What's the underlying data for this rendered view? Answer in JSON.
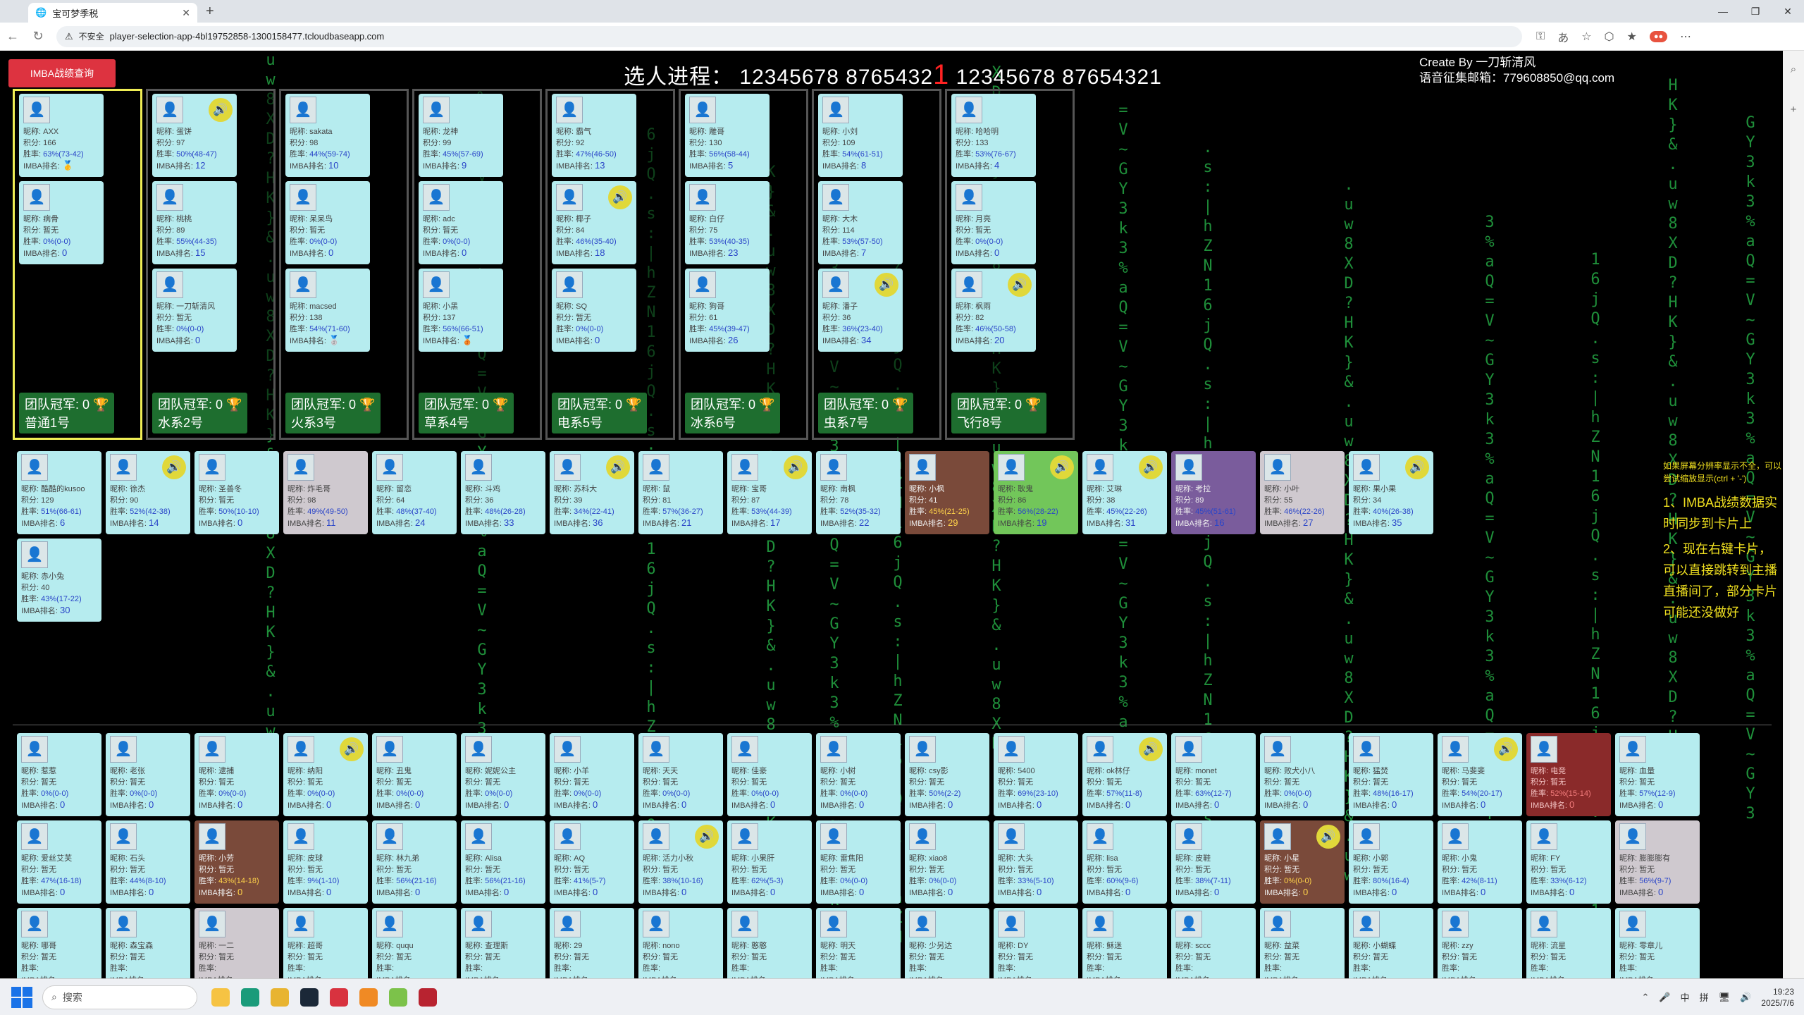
{
  "browser": {
    "tab_title": "宝可梦季税",
    "url": "player-selection-app-4bl19752858-1300158477.tcloudbaseapp.com",
    "security_label": "不安全"
  },
  "header": {
    "title_prefix": "选人进程：",
    "code_left": "12345678 8765432",
    "cursor_digit": "1",
    "code_right": "12345678 87654321",
    "creator_line1": "Create By 一刀斩清风",
    "creator_line2": "语音征集邮箱：779608850@qq.com",
    "query_button": "IMBA战绩查询"
  },
  "labels": {
    "nick": "昵称:",
    "score": "积分:",
    "winrate": "胜率:",
    "rank": "IMBA排名:",
    "team_champ": "团队冠军:"
  },
  "teams": [
    {
      "name": "普通1号",
      "champ": "0",
      "selected": true,
      "members": [
        {
          "nick": "AXX",
          "score": "166",
          "winrate": "63%(73-42)",
          "rank": "🥇"
        },
        {
          "nick": "病骨",
          "score": "暂无",
          "winrate": "0%(0-0)",
          "rank": "0"
        }
      ]
    },
    {
      "name": "水系2号",
      "champ": "0",
      "members": [
        {
          "nick": "蛋饼",
          "score": "97",
          "winrate": "50%(48-47)",
          "rank": "12",
          "spk": true
        },
        {
          "nick": "桃桃",
          "score": "89",
          "winrate": "55%(44-35)",
          "rank": "15"
        },
        {
          "nick": "一刀斩清风",
          "score": "暂无",
          "winrate": "0%(0-0)",
          "rank": "0"
        }
      ]
    },
    {
      "name": "火系3号",
      "champ": "0",
      "members": [
        {
          "nick": "sakata",
          "score": "98",
          "winrate": "44%(59-74)",
          "rank": "10"
        },
        {
          "nick": "呆呆鸟",
          "score": "暂无",
          "winrate": "0%(0-0)",
          "rank": "0"
        },
        {
          "nick": "macsed",
          "score": "138",
          "winrate": "54%(71-60)",
          "rank": "🥈"
        }
      ]
    },
    {
      "name": "草系4号",
      "champ": "0",
      "members": [
        {
          "nick": "龙神",
          "score": "99",
          "winrate": "45%(57-69)",
          "rank": "9"
        },
        {
          "nick": "adc",
          "score": "暂无",
          "winrate": "0%(0-0)",
          "rank": "0"
        },
        {
          "nick": "小黑",
          "score": "137",
          "winrate": "56%(66-51)",
          "rank": "🥉"
        }
      ]
    },
    {
      "name": "电系5号",
      "champ": "0",
      "members": [
        {
          "nick": "霸气",
          "score": "92",
          "winrate": "47%(46-50)",
          "rank": "13"
        },
        {
          "nick": "椰子",
          "score": "84",
          "winrate": "46%(35-40)",
          "rank": "18",
          "spk": true
        },
        {
          "nick": "SQ",
          "score": "暂无",
          "winrate": "0%(0-0)",
          "rank": "0"
        }
      ]
    },
    {
      "name": "冰系6号",
      "champ": "0",
      "members": [
        {
          "nick": "雕哥",
          "score": "130",
          "winrate": "56%(58-44)",
          "rank": "5"
        },
        {
          "nick": "白仔",
          "score": "75",
          "winrate": "53%(40-35)",
          "rank": "23"
        },
        {
          "nick": "狗哥",
          "score": "61",
          "winrate": "45%(39-47)",
          "rank": "26"
        }
      ]
    },
    {
      "name": "虫系7号",
      "champ": "0",
      "members": [
        {
          "nick": "小刘",
          "score": "109",
          "winrate": "54%(61-51)",
          "rank": "8"
        },
        {
          "nick": "大木",
          "score": "114",
          "winrate": "53%(57-50)",
          "rank": "7"
        },
        {
          "nick": "潘子",
          "score": "36",
          "winrate": "36%(23-40)",
          "rank": "34",
          "spk": true
        }
      ]
    },
    {
      "name": "飞行8号",
      "champ": "0",
      "members": [
        {
          "nick": "哈哈明",
          "score": "133",
          "winrate": "53%(76-67)",
          "rank": "4"
        },
        {
          "nick": "月亮",
          "score": "暂无",
          "winrate": "0%(0-0)",
          "rank": "0"
        },
        {
          "nick": "枫雨",
          "score": "82",
          "winrate": "46%(50-58)",
          "rank": "20",
          "spk": true
        }
      ]
    }
  ],
  "pool_ranked": [
    {
      "nick": "酷酷的kusoo",
      "score": "129",
      "winrate": "51%(66-61)",
      "rank": "6"
    },
    {
      "nick": "徐杰",
      "score": "90",
      "winrate": "52%(42-38)",
      "rank": "14",
      "spk": true
    },
    {
      "nick": "圣善冬",
      "score": "暂无",
      "winrate": "50%(10-10)",
      "rank": "0"
    },
    {
      "nick": "炸毛哥",
      "score": "98",
      "winrate": "49%(49-50)",
      "rank": "11",
      "style": "grey"
    },
    {
      "nick": "留恋",
      "score": "64",
      "winrate": "48%(37-40)",
      "rank": "24"
    },
    {
      "nick": "斗鸡",
      "score": "36",
      "winrate": "48%(26-28)",
      "rank": "33"
    },
    {
      "nick": "苏科大",
      "score": "39",
      "winrate": "34%(22-41)",
      "rank": "36",
      "spk": true
    },
    {
      "nick": "鼠",
      "score": "81",
      "winrate": "57%(36-27)",
      "rank": "21"
    },
    {
      "nick": "宝哥",
      "score": "87",
      "winrate": "53%(44-39)",
      "rank": "17",
      "spk": true
    },
    {
      "nick": "南枫",
      "score": "78",
      "winrate": "52%(35-32)",
      "rank": "22"
    },
    {
      "nick": "小枫",
      "score": "41",
      "winrate": "45%(21-25)",
      "rank": "29",
      "style": "dark"
    },
    {
      "nick": "耿鬼",
      "score": "86",
      "winrate": "56%(28-22)",
      "rank": "19",
      "style": "green",
      "spk": true
    },
    {
      "nick": "艾琳",
      "score": "38",
      "winrate": "45%(22-26)",
      "rank": "31",
      "spk": true
    },
    {
      "nick": "考拉",
      "score": "89",
      "winrate": "45%(51-61)",
      "rank": "16",
      "style": "purple"
    },
    {
      "nick": "小叶",
      "score": "55",
      "winrate": "46%(22-26)",
      "rank": "27",
      "style": "grey"
    },
    {
      "nick": "果小果",
      "score": "34",
      "winrate": "40%(26-38)",
      "rank": "35",
      "spk": true
    },
    {
      "nick": "赤小兔",
      "score": "40",
      "winrate": "43%(17-22)",
      "rank": "30"
    }
  ],
  "pool_other": [
    {
      "nick": "惹惹",
      "score": "暂无",
      "winrate": "0%(0-0)",
      "rank": "0"
    },
    {
      "nick": "老张",
      "score": "暂无",
      "winrate": "0%(0-0)",
      "rank": "0"
    },
    {
      "nick": "逮捕",
      "score": "暂无",
      "winrate": "0%(0-0)",
      "rank": "0"
    },
    {
      "nick": "纳阳",
      "score": "暂无",
      "winrate": "0%(0-0)",
      "rank": "0",
      "spk": true
    },
    {
      "nick": "丑鬼",
      "score": "暂无",
      "winrate": "0%(0-0)",
      "rank": "0"
    },
    {
      "nick": "妮妮公主",
      "score": "暂无",
      "winrate": "0%(0-0)",
      "rank": "0"
    },
    {
      "nick": "小羊",
      "score": "暂无",
      "winrate": "0%(0-0)",
      "rank": "0"
    },
    {
      "nick": "天天",
      "score": "暂无",
      "winrate": "0%(0-0)",
      "rank": "0"
    },
    {
      "nick": "佳豪",
      "score": "暂无",
      "winrate": "0%(0-0)",
      "rank": "0"
    },
    {
      "nick": "小树",
      "score": "暂无",
      "winrate": "0%(0-0)",
      "rank": "0"
    },
    {
      "nick": "csy影",
      "score": "暂无",
      "winrate": "50%(2-2)",
      "rank": "0"
    },
    {
      "nick": "5400",
      "score": "暂无",
      "winrate": "69%(23-10)",
      "rank": "0"
    },
    {
      "nick": "ok林仔",
      "score": "暂无",
      "winrate": "57%(11-8)",
      "rank": "0",
      "spk": true
    },
    {
      "nick": "monet",
      "score": "暂无",
      "winrate": "63%(12-7)",
      "rank": "0"
    },
    {
      "nick": "败犬小八",
      "score": "暂无",
      "winrate": "0%(0-0)",
      "rank": "0"
    },
    {
      "nick": "猛焚",
      "score": "暂无",
      "winrate": "48%(16-17)",
      "rank": "0"
    },
    {
      "nick": "马斐斐",
      "score": "暂无",
      "winrate": "54%(20-17)",
      "rank": "0",
      "spk": true
    },
    {
      "nick": "电竞",
      "score": "暂无",
      "winrate": "52%(15-14)",
      "rank": "0",
      "style": "red"
    },
    {
      "nick": "血量",
      "score": "暂无",
      "winrate": "57%(12-9)",
      "rank": "0"
    },
    {
      "nick": "爱丝艾芙",
      "score": "暂无",
      "winrate": "47%(16-18)",
      "rank": "0"
    },
    {
      "nick": "石头",
      "score": "暂无",
      "winrate": "44%(8-10)",
      "rank": "0"
    },
    {
      "nick": "小芳",
      "score": "暂无",
      "winrate": "43%(14-18)",
      "rank": "0",
      "style": "dark"
    },
    {
      "nick": "皮球",
      "score": "暂无",
      "winrate": "9%(1-10)",
      "rank": "0"
    },
    {
      "nick": "林九弟",
      "score": "暂无",
      "winrate": "56%(21-16)",
      "rank": "0"
    },
    {
      "nick": "Alisa",
      "score": "暂无",
      "winrate": "56%(21-16)",
      "rank": "0"
    },
    {
      "nick": "AQ",
      "score": "暂无",
      "winrate": "41%(5-7)",
      "rank": "0"
    },
    {
      "nick": "活力小秋",
      "score": "暂无",
      "winrate": "38%(10-16)",
      "rank": "0",
      "spk": true
    },
    {
      "nick": "小果肝",
      "score": "暂无",
      "winrate": "62%(5-3)",
      "rank": "0"
    },
    {
      "nick": "雷焦阳",
      "score": "暂无",
      "winrate": "0%(0-0)",
      "rank": "0"
    },
    {
      "nick": "xiao8",
      "score": "暂无",
      "winrate": "0%(0-0)",
      "rank": "0"
    },
    {
      "nick": "大头",
      "score": "暂无",
      "winrate": "33%(5-10)",
      "rank": "0"
    },
    {
      "nick": "lisa",
      "score": "暂无",
      "winrate": "60%(9-6)",
      "rank": "0"
    },
    {
      "nick": "皮鞋",
      "score": "暂无",
      "winrate": "38%(7-11)",
      "rank": "0"
    },
    {
      "nick": "小星",
      "score": "暂无",
      "winrate": "0%(0-0)",
      "rank": "0",
      "style": "dark",
      "spk": true
    },
    {
      "nick": "小郭",
      "score": "暂无",
      "winrate": "80%(16-4)",
      "rank": "0"
    },
    {
      "nick": "小鬼",
      "score": "暂无",
      "winrate": "42%(8-11)",
      "rank": "0"
    },
    {
      "nick": "FY",
      "score": "暂无",
      "winrate": "33%(6-12)",
      "rank": "0"
    },
    {
      "nick": "膨膨膨有",
      "score": "暂无",
      "winrate": "56%(9-7)",
      "rank": "0",
      "style": "grey"
    },
    {
      "nick": "哪哥",
      "score": "暂无",
      "winrate": "",
      "rank": ""
    },
    {
      "nick": "森宝森",
      "score": "暂无",
      "winrate": "",
      "rank": ""
    },
    {
      "nick": "一二",
      "score": "暂无",
      "winrate": "",
      "rank": "",
      "style": "grey"
    },
    {
      "nick": "超哥",
      "score": "暂无",
      "winrate": "",
      "rank": ""
    },
    {
      "nick": "ququ",
      "score": "暂无",
      "winrate": "",
      "rank": ""
    },
    {
      "nick": "查理斯",
      "score": "暂无",
      "winrate": "",
      "rank": ""
    },
    {
      "nick": "29",
      "score": "暂无",
      "winrate": "",
      "rank": ""
    },
    {
      "nick": "nono",
      "score": "暂无",
      "winrate": "",
      "rank": ""
    },
    {
      "nick": "憨憨",
      "score": "暂无",
      "winrate": "",
      "rank": ""
    },
    {
      "nick": "明天",
      "score": "暂无",
      "winrate": "",
      "rank": ""
    },
    {
      "nick": "少另达",
      "score": "暂无",
      "winrate": "",
      "rank": ""
    },
    {
      "nick": "DY",
      "score": "暂无",
      "winrate": "",
      "rank": ""
    },
    {
      "nick": "稣迷",
      "score": "暂无",
      "winrate": "",
      "rank": ""
    },
    {
      "nick": "sccc",
      "score": "暂无",
      "winrate": "",
      "rank": ""
    },
    {
      "nick": "益菜",
      "score": "暂无",
      "winrate": "",
      "rank": ""
    },
    {
      "nick": "小蝴蝶",
      "score": "暂无",
      "winrate": "",
      "rank": ""
    },
    {
      "nick": "zzy",
      "score": "暂无",
      "winrate": "",
      "rank": ""
    },
    {
      "nick": "流星",
      "score": "暂无",
      "winrate": "",
      "rank": ""
    },
    {
      "nick": "零章儿",
      "score": "暂无",
      "winrate": "",
      "rank": ""
    }
  ],
  "notes": {
    "tip": "如果屏幕分辨率显示不全，可以尝试缩放显示(ctrl + '-')",
    "note1": "1、IMBA战绩数据实时同步到卡片上",
    "note2": "2、现在右键卡片，可以直接跳转到主播直播间了，部分卡片可能还没做好"
  },
  "taskbar": {
    "search_placeholder": "搜索",
    "ime1": "中",
    "ime2": "拼",
    "time": "19:23",
    "date": "2025/7/6"
  },
  "colors": {
    "card_bg": "#b6ecef",
    "accent_red": "#dd3340",
    "selected_team_border": "#f0ee55",
    "champ_green": "#1e6e2f",
    "note_yellow": "#f0e020",
    "matrix_green": "#1f8f3a"
  }
}
